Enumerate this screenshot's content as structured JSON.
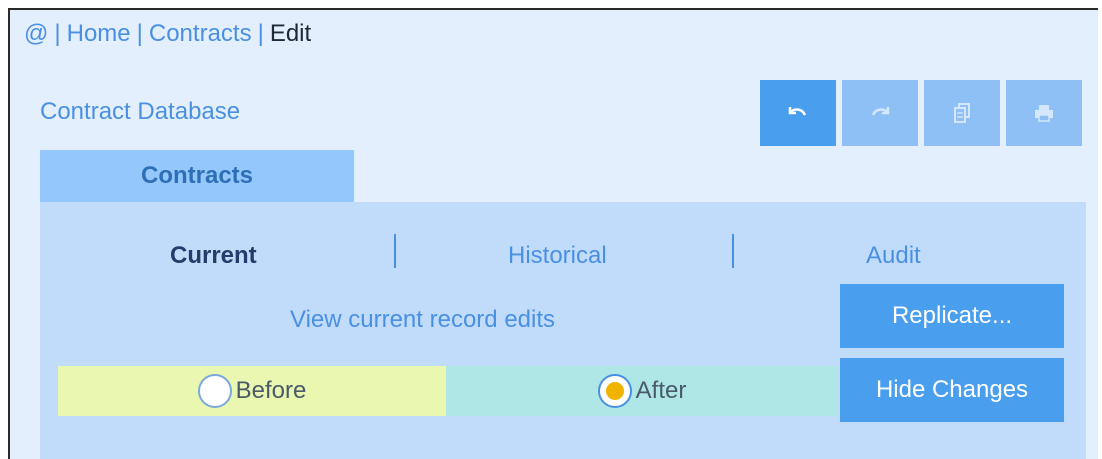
{
  "breadcrumb": {
    "root": "@",
    "separator": "|",
    "items": [
      "Home",
      "Contracts",
      "Edit"
    ]
  },
  "app": {
    "title": "Contract Database"
  },
  "toolbar": {
    "undo_icon": "undo-icon",
    "redo_icon": "redo-icon",
    "copy_icon": "copy-icon",
    "print_icon": "print-icon"
  },
  "tabs": {
    "active": "Contracts"
  },
  "subtabs": [
    {
      "label": "Current",
      "active": true
    },
    {
      "label": "Historical",
      "active": false
    },
    {
      "label": "Audit",
      "active": false
    }
  ],
  "panel": {
    "description": "View current record edits",
    "replicate_label": "Replicate...",
    "hide_changes_label": "Hide Changes"
  },
  "options": {
    "before": {
      "label": "Before",
      "selected": false
    },
    "after": {
      "label": "After",
      "selected": true
    }
  },
  "colors": {
    "background": "#e3effc",
    "accent": "#4a9eee",
    "accent_disabled": "#8ec0f5",
    "panel": "#c0dcfa",
    "before_bg": "#eaf7b0",
    "after_bg": "#aee7e6",
    "radio_dot": "#f0b400"
  }
}
